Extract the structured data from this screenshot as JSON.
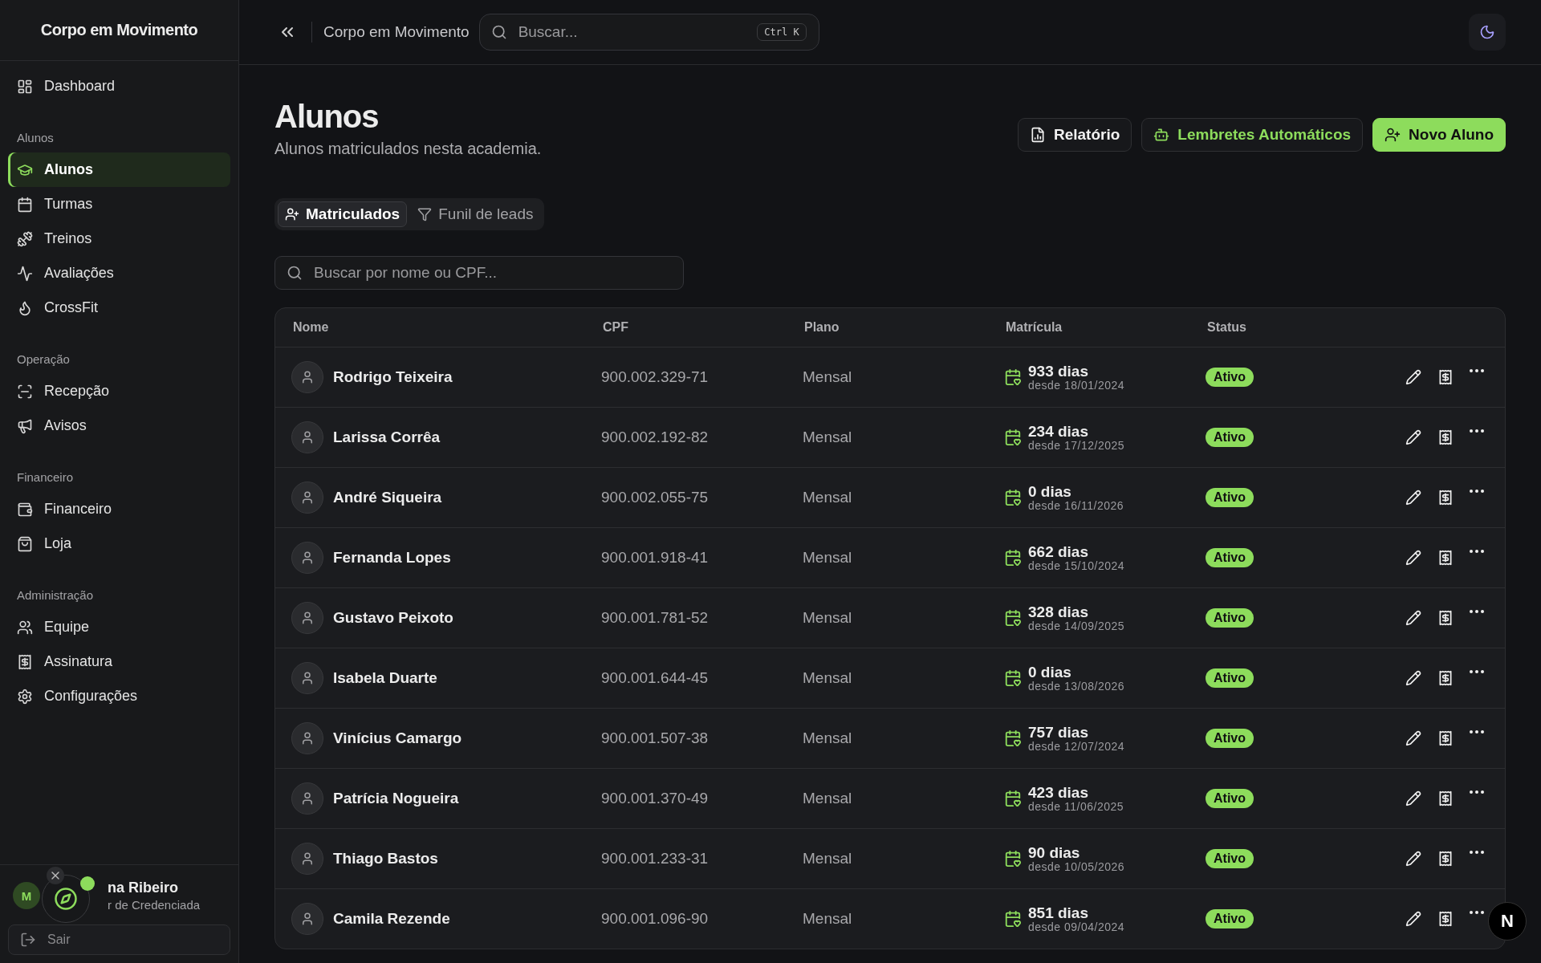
{
  "sidebar": {
    "brand": "Corpo em Movimento",
    "top_items": [
      {
        "label": "Dashboard",
        "selected": false
      }
    ],
    "sections": [
      {
        "title": "Alunos",
        "items": [
          {
            "label": "Alunos",
            "selected": true
          },
          {
            "label": "Turmas",
            "selected": false
          },
          {
            "label": "Treinos",
            "selected": false
          },
          {
            "label": "Avaliações",
            "selected": false
          },
          {
            "label": "CrossFit",
            "selected": false
          }
        ]
      },
      {
        "title": "Operação",
        "items": [
          {
            "label": "Recepção",
            "selected": false
          },
          {
            "label": "Avisos",
            "selected": false
          }
        ]
      },
      {
        "title": "Financeiro",
        "items": [
          {
            "label": "Financeiro",
            "selected": false
          },
          {
            "label": "Loja",
            "selected": false
          }
        ]
      },
      {
        "title": "Administração",
        "items": [
          {
            "label": "Equipe",
            "selected": false
          },
          {
            "label": "Assinatura",
            "selected": false
          },
          {
            "label": "Configurações",
            "selected": false
          }
        ]
      }
    ],
    "user": {
      "avatar": "M",
      "name": "na Ribeiro",
      "role": "r de Credenciada"
    },
    "logout": "Sair"
  },
  "header": {
    "breadcrumb": "Corpo em Movimento",
    "search": {
      "placeholder": "Buscar...",
      "shortcut": "Ctrl K"
    }
  },
  "page": {
    "title": "Alunos",
    "subtitle": "Alunos matriculados nesta academia.",
    "buttons": [
      {
        "label": "Relatório",
        "kind": "outline"
      },
      {
        "label": "Lembretes Automáticos",
        "kind": "accent-outline"
      },
      {
        "label": "Novo Aluno",
        "kind": "primary"
      }
    ]
  },
  "tabs": [
    {
      "label": "Matriculados",
      "selected": true
    },
    {
      "label": "Funil de leads",
      "selected": false
    }
  ],
  "filter": {
    "placeholder": "Buscar por nome ou CPF..."
  },
  "table": {
    "columns": [
      "Nome",
      "CPF",
      "Plano",
      "Matrícula",
      "Status"
    ],
    "rows": [
      {
        "name": "Rodrigo Teixeira",
        "cpf": "900.002.329-71",
        "plan": "Mensal",
        "days": "933 dias",
        "since": "desde 18/01/2024",
        "status": "Ativo"
      },
      {
        "name": "Larissa Corrêa",
        "cpf": "900.002.192-82",
        "plan": "Mensal",
        "days": "234 dias",
        "since": "desde 17/12/2025",
        "status": "Ativo"
      },
      {
        "name": "André Siqueira",
        "cpf": "900.002.055-75",
        "plan": "Mensal",
        "days": "0 dias",
        "since": "desde 16/11/2026",
        "status": "Ativo"
      },
      {
        "name": "Fernanda Lopes",
        "cpf": "900.001.918-41",
        "plan": "Mensal",
        "days": "662 dias",
        "since": "desde 15/10/2024",
        "status": "Ativo"
      },
      {
        "name": "Gustavo Peixoto",
        "cpf": "900.001.781-52",
        "plan": "Mensal",
        "days": "328 dias",
        "since": "desde 14/09/2025",
        "status": "Ativo"
      },
      {
        "name": "Isabela Duarte",
        "cpf": "900.001.644-45",
        "plan": "Mensal",
        "days": "0 dias",
        "since": "desde 13/08/2026",
        "status": "Ativo"
      },
      {
        "name": "Vinícius Camargo",
        "cpf": "900.001.507-38",
        "plan": "Mensal",
        "days": "757 dias",
        "since": "desde 12/07/2024",
        "status": "Ativo"
      },
      {
        "name": "Patrícia Nogueira",
        "cpf": "900.001.370-49",
        "plan": "Mensal",
        "days": "423 dias",
        "since": "desde 11/06/2025",
        "status": "Ativo"
      },
      {
        "name": "Thiago Bastos",
        "cpf": "900.001.233-31",
        "plan": "Mensal",
        "days": "90 dias",
        "since": "desde 10/05/2026",
        "status": "Ativo"
      },
      {
        "name": "Camila Rezende",
        "cpf": "900.001.096-90",
        "plan": "Mensal",
        "days": "851 dias",
        "since": "desde 09/04/2024",
        "status": "Ativo"
      }
    ]
  },
  "dev_badge": "N"
}
